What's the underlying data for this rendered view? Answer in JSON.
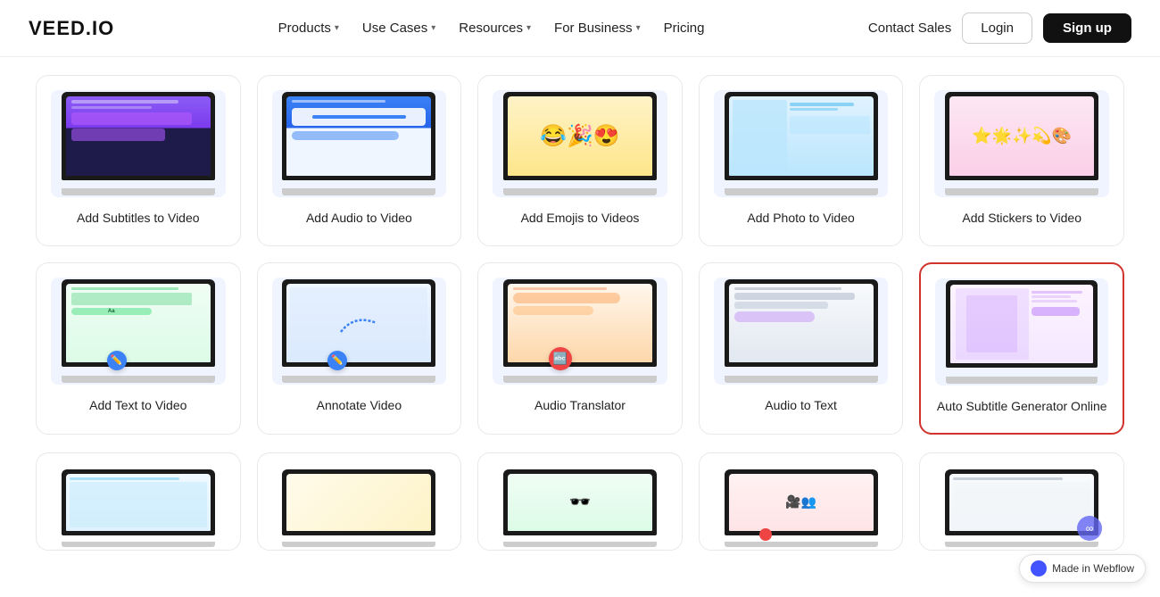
{
  "nav": {
    "logo": "VEED.IO",
    "links": [
      {
        "label": "Products",
        "hasChevron": true
      },
      {
        "label": "Use Cases",
        "hasChevron": true
      },
      {
        "label": "Resources",
        "hasChevron": true
      },
      {
        "label": "For Business",
        "hasChevron": true
      },
      {
        "label": "Pricing",
        "hasChevron": false
      }
    ],
    "contact_sales": "Contact Sales",
    "login": "Login",
    "signup": "Sign up"
  },
  "cards": [
    {
      "label": "Add Subtitles to Video",
      "thumb_class": "mockup-subtitles",
      "highlighted": false
    },
    {
      "label": "Add Audio to Video",
      "thumb_class": "mockup-audio",
      "highlighted": false
    },
    {
      "label": "Add Emojis to Videos",
      "thumb_class": "mockup-emoji",
      "highlighted": false
    },
    {
      "label": "Add Photo to Video",
      "thumb_class": "mockup-photo",
      "highlighted": false
    },
    {
      "label": "Add Stickers to Video",
      "thumb_class": "mockup-stickers",
      "highlighted": false
    },
    {
      "label": "Add Text to Video",
      "thumb_class": "mockup-text",
      "highlighted": false
    },
    {
      "label": "Annotate Video",
      "thumb_class": "mockup-annotate",
      "highlighted": false
    },
    {
      "label": "Audio Translator",
      "thumb_class": "mockup-translator",
      "highlighted": false
    },
    {
      "label": "Audio to Text",
      "thumb_class": "mockup-a2t",
      "highlighted": false
    },
    {
      "label": "Auto Subtitle Generator Online",
      "thumb_class": "mockup-autosub",
      "highlighted": true
    }
  ],
  "partial_cards": [
    {
      "thumb_class": "mockup-row3a"
    },
    {
      "thumb_class": "mockup-row3b"
    },
    {
      "thumb_class": "mockup-row3c"
    },
    {
      "thumb_class": "mockup-row3d"
    },
    {
      "thumb_class": "mockup-row3e"
    }
  ],
  "webflow": {
    "label": "Made in Webflow"
  }
}
